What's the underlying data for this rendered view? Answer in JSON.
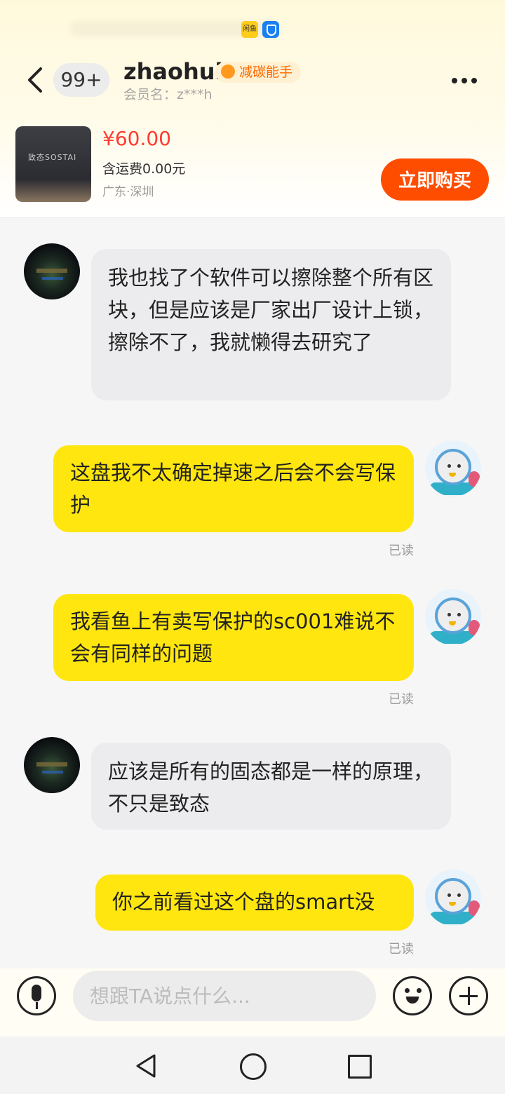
{
  "status_bar": {
    "app1_icon": "app-icon-yellow",
    "app1_text": "闲鱼",
    "app2_icon": "shield-app-icon"
  },
  "header": {
    "back_icon": "chevron-left-icon",
    "unread_count": "99+",
    "contact_name": "zhaohui",
    "badge_label": "减碳能手",
    "member_label": "会员名：z***h",
    "more_icon": "more-dots-icon"
  },
  "product": {
    "image_text": "致态SOSTAI",
    "price": "¥60.00",
    "shipping": "含运费0.00元",
    "location": "广东·深圳",
    "buy_button": "立即购买"
  },
  "messages": [
    {
      "side": "left",
      "text": "我也找了个软件可以擦除整个所有区块，但是应该是厂家出厂设计上锁，擦除不了，我就懒得去研究了"
    },
    {
      "side": "right",
      "text": "这盘我不太确定掉速之后会不会写保护",
      "status": "已读"
    },
    {
      "side": "right",
      "text": "我看鱼上有卖写保护的sc001难说不会有同样的问题",
      "status": "已读"
    },
    {
      "side": "left",
      "text": "应该是所有的固态都是一样的原理，不只是致态"
    },
    {
      "side": "right",
      "text": "你之前看过这个盘的smart没",
      "status": "已读"
    }
  ],
  "input_bar": {
    "placeholder": "想跟TA说点什么...",
    "mic_icon": "microphone-icon",
    "emoji_icon": "emoji-icon",
    "plus_icon": "plus-icon"
  },
  "nav": {
    "back": "triangle-back-icon",
    "home": "circle-home-icon",
    "recent": "square-recent-icon"
  },
  "colors": {
    "price": "#ff3b30",
    "buy": "#ff4d00",
    "bubble_self": "#ffe60f",
    "bubble_other": "#ececee"
  }
}
